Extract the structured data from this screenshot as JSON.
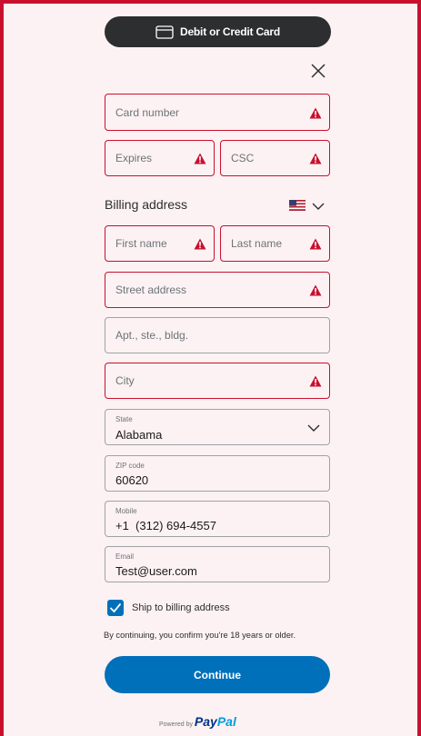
{
  "payment_method_button": {
    "label": "Debit or Credit Card",
    "icon": "credit-card-icon"
  },
  "close_icon": "close-icon",
  "fields": {
    "card_number": {
      "placeholder": "Card number"
    },
    "expires": {
      "placeholder": "Expires"
    },
    "csc": {
      "placeholder": "CSC"
    },
    "first_name": {
      "placeholder": "First name"
    },
    "last_name": {
      "placeholder": "Last name"
    },
    "street": {
      "placeholder": "Street address"
    },
    "apt": {
      "placeholder": "Apt., ste., bldg."
    },
    "city": {
      "placeholder": "City"
    },
    "state": {
      "label": "State",
      "value": "Alabama"
    },
    "zip": {
      "label": "ZIP code",
      "value": "60620"
    },
    "mobile": {
      "label": "Mobile",
      "value": "+1  (312) 694-4557"
    },
    "email": {
      "label": "Email",
      "value": "Test@user.com"
    }
  },
  "billing": {
    "heading": "Billing address",
    "country_flag": "us-flag-icon"
  },
  "ship_to_billing": {
    "label": "Ship to billing address",
    "checked": true
  },
  "disclaimer": "By continuing, you confirm you're 18 years or older.",
  "continue_label": "Continue",
  "powered_by": {
    "text": "Powered by",
    "brand_a": "Pay",
    "brand_b": "Pal"
  },
  "colors": {
    "error": "#c8102e",
    "primary": "#0070ba",
    "dark": "#2c2e2f",
    "background": "#fdf2f3"
  }
}
